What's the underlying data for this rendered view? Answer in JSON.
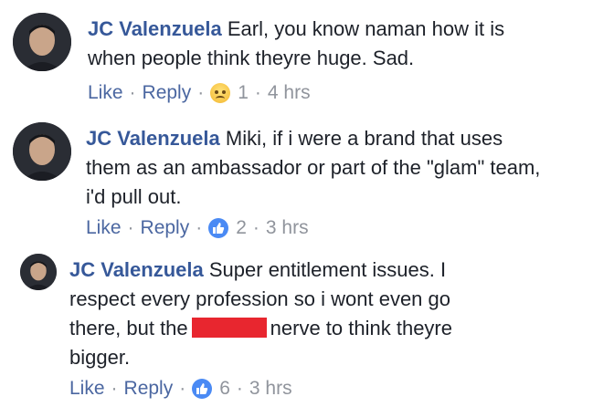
{
  "comments": [
    {
      "author": "JC Valenzuela",
      "lines": [
        "Earl, you know naman how it is",
        "when people think theyre huge. Sad."
      ],
      "like_label": "Like",
      "reply_label": "Reply",
      "reaction_icon": "sad-reaction-icon",
      "reaction_count": "1",
      "time": "4 hrs"
    },
    {
      "author": "JC Valenzuela",
      "lines": [
        "Miki, if i were a brand that uses",
        "them as an ambassador or part of the \"glam\" team,",
        "i'd pull out."
      ],
      "like_label": "Like",
      "reply_label": "Reply",
      "reaction_icon": "like-reaction-icon",
      "reaction_count": "2",
      "time": "3 hrs"
    },
    {
      "author": "JC Valenzuela",
      "lines": [
        "Super entitlement issues. I",
        "respect every profession so i wont even go",
        "there, but the",
        "nerve to think theyre",
        "bigger."
      ],
      "like_label": "Like",
      "reply_label": "Reply",
      "reaction_icon": "like-reaction-icon",
      "reaction_count": "6",
      "time": "3 hrs"
    }
  ],
  "colors": {
    "author": "#365899",
    "body_text": "#1d2129",
    "meta_text": "#90949c",
    "redaction": "#e8262f",
    "like_blue": "#4a8af4"
  },
  "separator": "·"
}
